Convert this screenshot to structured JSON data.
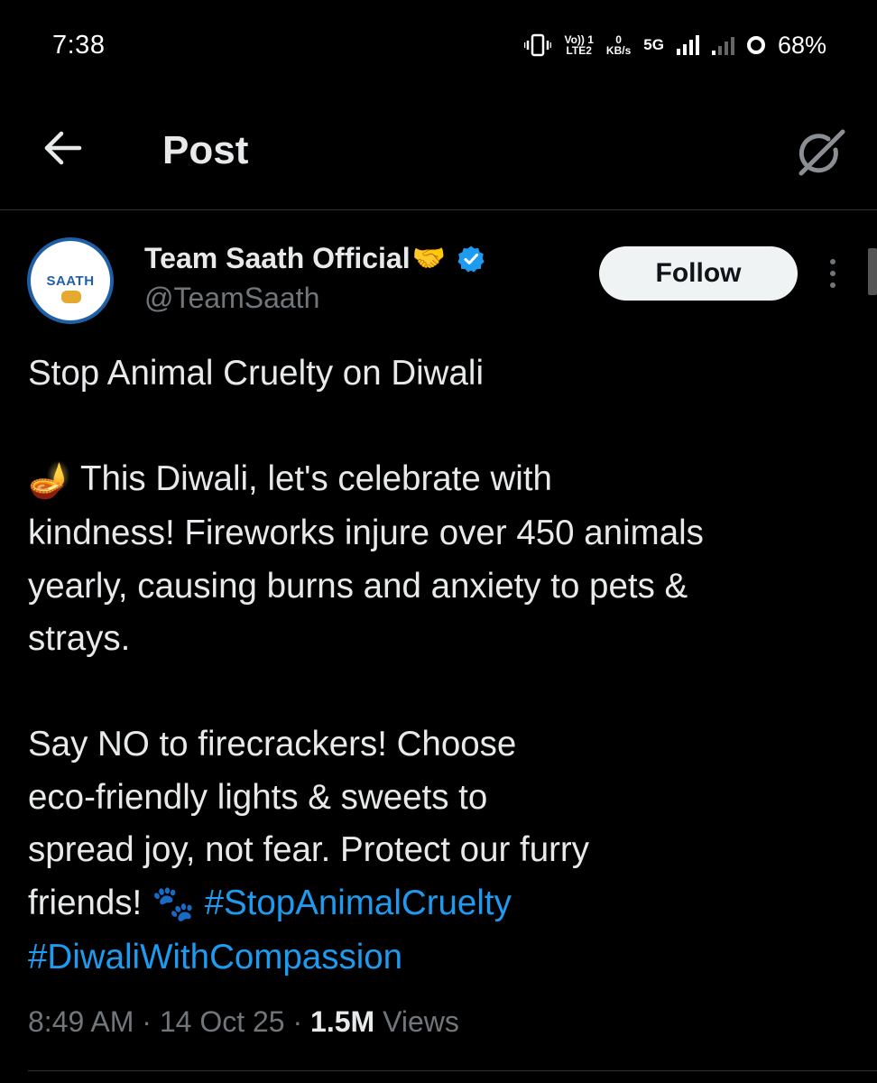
{
  "status_bar": {
    "time": "7:38",
    "volte_top": "Vo)) 1",
    "volte_bottom": "LTE2",
    "speed_value": "0",
    "speed_unit": "KB/s",
    "network": "5G",
    "battery": "68%",
    "icons": [
      "vibrate-icon",
      "signal-icon",
      "battery-icon"
    ]
  },
  "header": {
    "title": "Post",
    "back_icon": "arrow-left-icon",
    "grok_icon": "grok-icon"
  },
  "author": {
    "display_name": "Team Saath Official",
    "name_emoji": "🤝",
    "handle": "@TeamSaath",
    "avatar_text": "SAATH",
    "verified": true,
    "verified_color": "#1d9bf0"
  },
  "follow_button": {
    "label": "Follow"
  },
  "post": {
    "line1": "Stop Animal Cruelty on Diwali",
    "diya_emoji": "🪔",
    "para2_line1": " This Diwali, let's celebrate with",
    "para2_line2": "kindness! Fireworks injure over 450 animals",
    "para2_line3": "yearly, causing burns and anxiety to pets &",
    "para2_line4": "strays.",
    "para3_line1": "Say NO to firecrackers! Choose",
    "para3_line2": "eco-friendly lights & sweets to",
    "para3_line3": "spread joy, not fear. Protect our furry",
    "para3_line4_text": "friends! ",
    "paw_emoji": "🐾",
    "hashtag1": "#StopAnimalCruelty",
    "hashtag2": "#DiwaliWithCompassion",
    "hashtag_color": "#1d9bf0"
  },
  "meta": {
    "time": "8:49 AM",
    "sep1": " · ",
    "date": "14 Oct 25",
    "sep2": " · ",
    "views_count": "1.5M",
    "views_label": " Views"
  }
}
